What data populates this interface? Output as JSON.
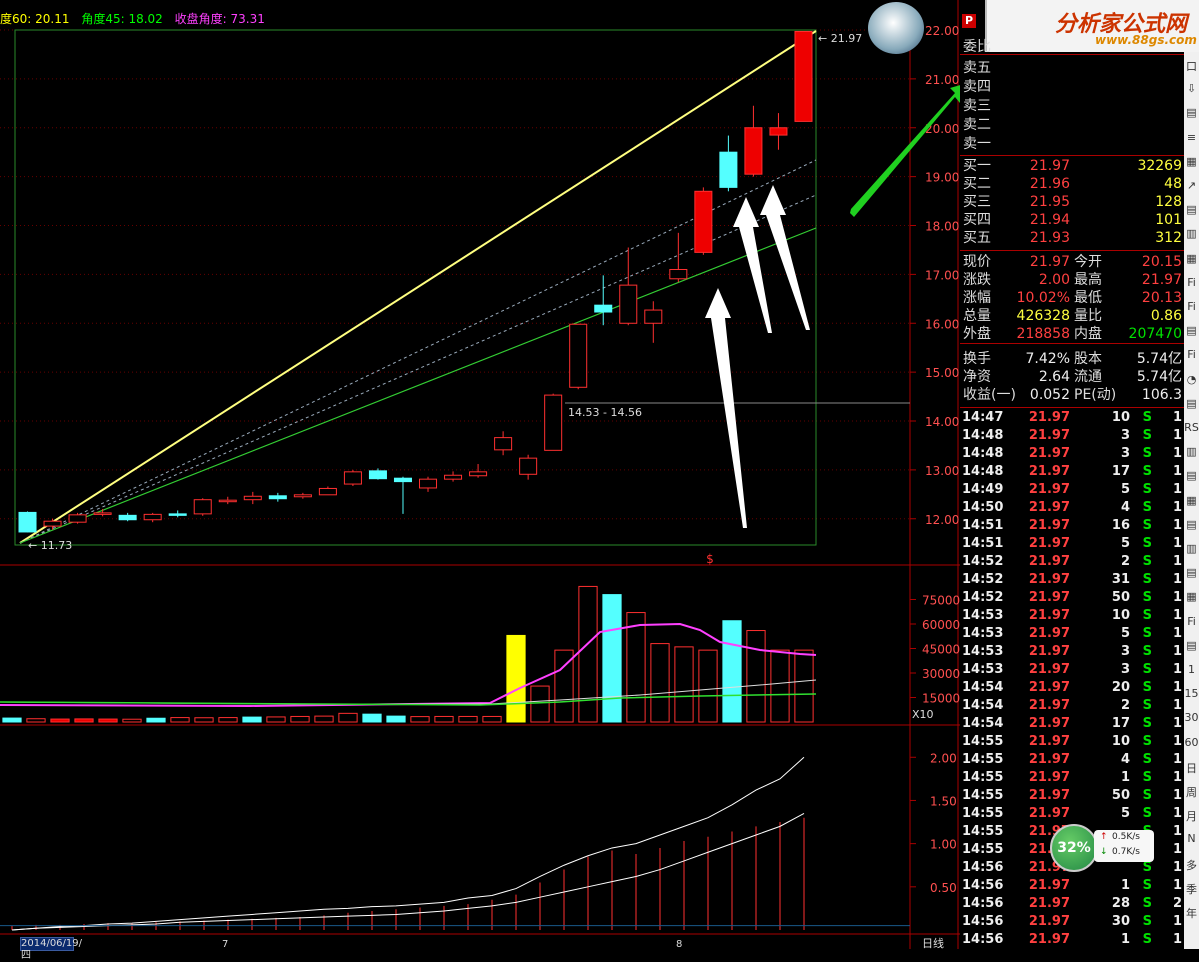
{
  "header": {
    "ma60": "度60: 20.11",
    "angle45": "角度45: 18.02",
    "close_angle": "收盘角度: 73.31"
  },
  "logo": {
    "text": "分析家公式网",
    "url": "www.88gs.com"
  },
  "colors": {
    "up": "#ff3030",
    "down": "#54ffff",
    "label": "#ff5050",
    "yellow": "#ffff00",
    "green": "#00d000",
    "magenta": "#ff40ff",
    "white": "#ffffff"
  },
  "chart_data": [
    {
      "type": "candlestick",
      "price_labels": [
        "22.00",
        "21.00",
        "20.00",
        "19.00",
        "18.00",
        "17.00",
        "16.00",
        "15.00",
        "14.00",
        "13.00",
        "12.00"
      ],
      "ylim": [
        11.7,
        22.0
      ],
      "candles": [
        {
          "o": 12.13,
          "c": 11.73,
          "h": 12.15,
          "l": 11.72
        },
        {
          "o": 11.85,
          "c": 11.95,
          "h": 12.0,
          "l": 11.78
        },
        {
          "o": 11.93,
          "c": 12.08,
          "h": 12.12,
          "l": 11.9
        },
        {
          "o": 12.1,
          "c": 12.12,
          "h": 12.2,
          "l": 12.05
        },
        {
          "o": 12.07,
          "c": 11.98,
          "h": 12.12,
          "l": 11.95
        },
        {
          "o": 11.98,
          "c": 12.09,
          "h": 12.12,
          "l": 11.93
        },
        {
          "o": 12.1,
          "c": 12.08,
          "h": 12.17,
          "l": 12.03
        },
        {
          "o": 12.1,
          "c": 12.39,
          "h": 12.42,
          "l": 12.06
        },
        {
          "o": 12.38,
          "c": 12.38,
          "h": 12.45,
          "l": 12.3
        },
        {
          "o": 12.39,
          "c": 12.46,
          "h": 12.55,
          "l": 12.3
        },
        {
          "o": 12.47,
          "c": 12.41,
          "h": 12.53,
          "l": 12.35
        },
        {
          "o": 12.45,
          "c": 12.49,
          "h": 12.53,
          "l": 12.41
        },
        {
          "o": 12.49,
          "c": 12.62,
          "h": 12.66,
          "l": 12.49
        },
        {
          "o": 12.71,
          "c": 12.96,
          "h": 13.0,
          "l": 12.67
        },
        {
          "o": 12.98,
          "c": 12.82,
          "h": 13.03,
          "l": 12.8
        },
        {
          "o": 12.83,
          "c": 12.76,
          "h": 12.86,
          "l": 12.1
        },
        {
          "o": 12.63,
          "c": 12.81,
          "h": 12.86,
          "l": 12.55
        },
        {
          "o": 12.81,
          "c": 12.89,
          "h": 12.97,
          "l": 12.76
        },
        {
          "o": 12.88,
          "c": 12.96,
          "h": 13.12,
          "l": 12.84
        },
        {
          "o": 13.41,
          "c": 13.66,
          "h": 13.79,
          "l": 13.3
        },
        {
          "o": 12.91,
          "c": 13.24,
          "h": 13.31,
          "l": 12.8
        },
        {
          "o": 13.4,
          "c": 14.53,
          "h": 14.56,
          "l": 13.4
        },
        {
          "o": 14.69,
          "c": 15.98,
          "h": 15.98,
          "l": 14.65
        },
        {
          "o": 16.37,
          "c": 16.23,
          "h": 16.98,
          "l": 15.96
        },
        {
          "o": 16.0,
          "c": 16.78,
          "h": 17.55,
          "l": 15.96
        },
        {
          "o": 16.0,
          "c": 16.27,
          "h": 16.45,
          "l": 15.6
        },
        {
          "o": 16.91,
          "c": 17.1,
          "h": 17.85,
          "l": 16.84
        },
        {
          "o": 17.45,
          "c": 18.7,
          "h": 18.78,
          "l": 17.4
        },
        {
          "o": 19.5,
          "c": 18.78,
          "h": 19.84,
          "l": 18.7
        },
        {
          "o": 19.05,
          "c": 20.0,
          "h": 20.45,
          "l": 19.0
        },
        {
          "o": 19.85,
          "c": 20.0,
          "h": 20.3,
          "l": 19.55
        },
        {
          "o": 20.13,
          "c": 21.97,
          "h": 21.97,
          "l": 20.13
        }
      ],
      "annotations": {
        "low_label": "11.73",
        "high_label": "21.97",
        "range_label": "14.53 - 14.56",
        "marker": "$"
      }
    },
    {
      "type": "bar",
      "title": "volume",
      "y_labels": [
        "75000",
        "60000",
        "45000",
        "30000",
        "15000"
      ],
      "unit_label": "X10",
      "values": [
        2400,
        2000,
        1800,
        1900,
        1800,
        1700,
        2300,
        2700,
        2600,
        2700,
        3000,
        3100,
        3400,
        3600,
        5300,
        4800,
        3600,
        3300,
        3400,
        3400,
        3400,
        53000,
        22000,
        44000,
        83000,
        78000,
        67000,
        48000,
        46000,
        44000,
        62000,
        56000,
        44000,
        44000
      ],
      "colors": [
        "c",
        "r",
        "R",
        "R",
        "R",
        "r",
        "c",
        "r",
        "r",
        "r",
        "c",
        "r",
        "r",
        "r",
        "r",
        "c",
        "c",
        "r",
        "r",
        "r",
        "r",
        "Y",
        "r",
        "r",
        "r",
        "c",
        "r",
        "r",
        "r",
        "r",
        "c",
        "r",
        "r",
        "r"
      ]
    },
    {
      "type": "line",
      "y_labels": [
        "2.00",
        "1.50",
        "1.00",
        "0.50"
      ],
      "bottom_labels": [
        "2014/06/19/四",
        "7",
        "8",
        "日线"
      ]
    }
  ],
  "quote": {
    "weibi": "委比",
    "sell_labels": [
      "卖五",
      "卖四",
      "卖三",
      "卖二",
      "卖一"
    ],
    "buy": [
      {
        "label": "买一",
        "price": "21.97",
        "vol": "32269"
      },
      {
        "label": "买二",
        "price": "21.96",
        "vol": "48"
      },
      {
        "label": "买三",
        "price": "21.95",
        "vol": "128"
      },
      {
        "label": "买四",
        "price": "21.94",
        "vol": "101"
      },
      {
        "label": "买五",
        "price": "21.93",
        "vol": "312"
      }
    ],
    "stats": [
      {
        "l1": "现价",
        "v1": "21.97",
        "l2": "今开",
        "v2": "20.15"
      },
      {
        "l1": "涨跌",
        "v1": "2.00",
        "l2": "最高",
        "v2": "21.97"
      },
      {
        "l1": "涨幅",
        "v1": "10.02%",
        "l2": "最低",
        "v2": "20.13"
      },
      {
        "l1": "总量",
        "v1": "426328",
        "l2": "量比",
        "v2": "0.86"
      },
      {
        "l1": "外盘",
        "v1": "218858",
        "l2": "内盘",
        "v2": "207470"
      }
    ],
    "stats2": [
      {
        "l1": "换手",
        "v1": "7.42%",
        "l2": "股本",
        "v2": "5.74亿"
      },
      {
        "l1": "净资",
        "v1": "2.64",
        "l2": "流通",
        "v2": "5.74亿"
      },
      {
        "l1": "收益(一)",
        "v1": "0.052",
        "l2": "PE(动)",
        "v2": "106.3"
      }
    ],
    "ticks": [
      [
        "14:47",
        "21.97",
        "10",
        "S",
        "1"
      ],
      [
        "14:48",
        "21.97",
        "3",
        "S",
        "1"
      ],
      [
        "14:48",
        "21.97",
        "3",
        "S",
        "1"
      ],
      [
        "14:48",
        "21.97",
        "17",
        "S",
        "1"
      ],
      [
        "14:49",
        "21.97",
        "5",
        "S",
        "1"
      ],
      [
        "14:50",
        "21.97",
        "4",
        "S",
        "1"
      ],
      [
        "14:51",
        "21.97",
        "16",
        "S",
        "1"
      ],
      [
        "14:51",
        "21.97",
        "5",
        "S",
        "1"
      ],
      [
        "14:52",
        "21.97",
        "2",
        "S",
        "1"
      ],
      [
        "14:52",
        "21.97",
        "31",
        "S",
        "1"
      ],
      [
        "14:52",
        "21.97",
        "50",
        "S",
        "1"
      ],
      [
        "14:53",
        "21.97",
        "10",
        "S",
        "1"
      ],
      [
        "14:53",
        "21.97",
        "5",
        "S",
        "1"
      ],
      [
        "14:53",
        "21.97",
        "3",
        "S",
        "1"
      ],
      [
        "14:53",
        "21.97",
        "3",
        "S",
        "1"
      ],
      [
        "14:54",
        "21.97",
        "20",
        "S",
        "1"
      ],
      [
        "14:54",
        "21.97",
        "2",
        "S",
        "1"
      ],
      [
        "14:54",
        "21.97",
        "17",
        "S",
        "1"
      ],
      [
        "14:55",
        "21.97",
        "10",
        "S",
        "1"
      ],
      [
        "14:55",
        "21.97",
        "4",
        "S",
        "1"
      ],
      [
        "14:55",
        "21.97",
        "1",
        "S",
        "1"
      ],
      [
        "14:55",
        "21.97",
        "50",
        "S",
        "1"
      ],
      [
        "14:55",
        "21.97",
        "5",
        "S",
        "1"
      ],
      [
        "14:55",
        "21.97",
        "",
        "S",
        "1"
      ],
      [
        "14:55",
        "21.97",
        "",
        "S",
        "1"
      ],
      [
        "14:56",
        "21.97",
        "",
        "S",
        "1"
      ],
      [
        "14:56",
        "21.97",
        "1",
        "S",
        "1"
      ],
      [
        "14:56",
        "21.97",
        "28",
        "S",
        "2"
      ],
      [
        "14:56",
        "21.97",
        "30",
        "S",
        "1"
      ],
      [
        "14:56",
        "21.97",
        "1",
        "S",
        "1"
      ]
    ]
  },
  "toolbar_items": [
    "口",
    "⇩",
    "▤",
    "≡",
    "▦",
    "↗",
    "▤",
    "▥",
    "▦",
    "Fi",
    "Fi",
    "▤",
    "Fi",
    "◔",
    "▤",
    "RS",
    "▥",
    "▤",
    "▦",
    "▤",
    "▥",
    "▤",
    "▦",
    "Fi",
    "▤",
    "1",
    "15",
    "30",
    "60",
    "日",
    "周",
    "月",
    "N",
    "多",
    "季",
    "年"
  ],
  "net": {
    "percent": "32%",
    "up": "0.5K/s",
    "down": "0.7K/s"
  }
}
